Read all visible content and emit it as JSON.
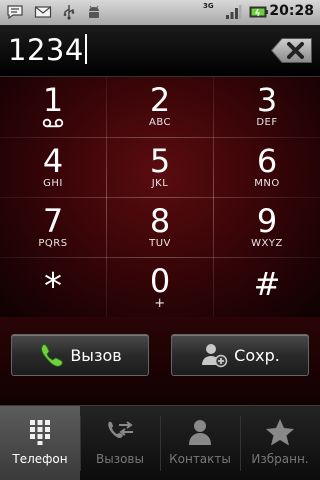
{
  "status_bar": {
    "time": "20:28",
    "network": "3G",
    "icons": [
      "sms-icon",
      "mail-icon",
      "usb-icon",
      "android-debug-icon",
      "signal-icon",
      "battery-icon"
    ]
  },
  "dialer": {
    "number": "1234"
  },
  "keypad": [
    {
      "digit": "1",
      "letters": ""
    },
    {
      "digit": "2",
      "letters": "ABC"
    },
    {
      "digit": "3",
      "letters": "DEF"
    },
    {
      "digit": "4",
      "letters": "GHI"
    },
    {
      "digit": "5",
      "letters": "JKL"
    },
    {
      "digit": "6",
      "letters": "MNO"
    },
    {
      "digit": "7",
      "letters": "PQRS"
    },
    {
      "digit": "8",
      "letters": "TUV"
    },
    {
      "digit": "9",
      "letters": "WXYZ"
    },
    {
      "digit": "*",
      "letters": ""
    },
    {
      "digit": "0",
      "letters": "+"
    },
    {
      "digit": "#",
      "letters": ""
    }
  ],
  "actions": {
    "call_label": "Вызов",
    "save_label": "Сохр."
  },
  "tabs": [
    {
      "label": "Телефон",
      "icon": "dialpad-icon",
      "active": true
    },
    {
      "label": "Вызовы",
      "icon": "call-log-icon",
      "active": false
    },
    {
      "label": "Контакты",
      "icon": "contacts-icon",
      "active": false
    },
    {
      "label": "Избранн.",
      "icon": "favorites-star-icon",
      "active": false
    }
  ],
  "colors": {
    "keypad_bg": "#3a0508",
    "call_green": "#5fc23a"
  }
}
